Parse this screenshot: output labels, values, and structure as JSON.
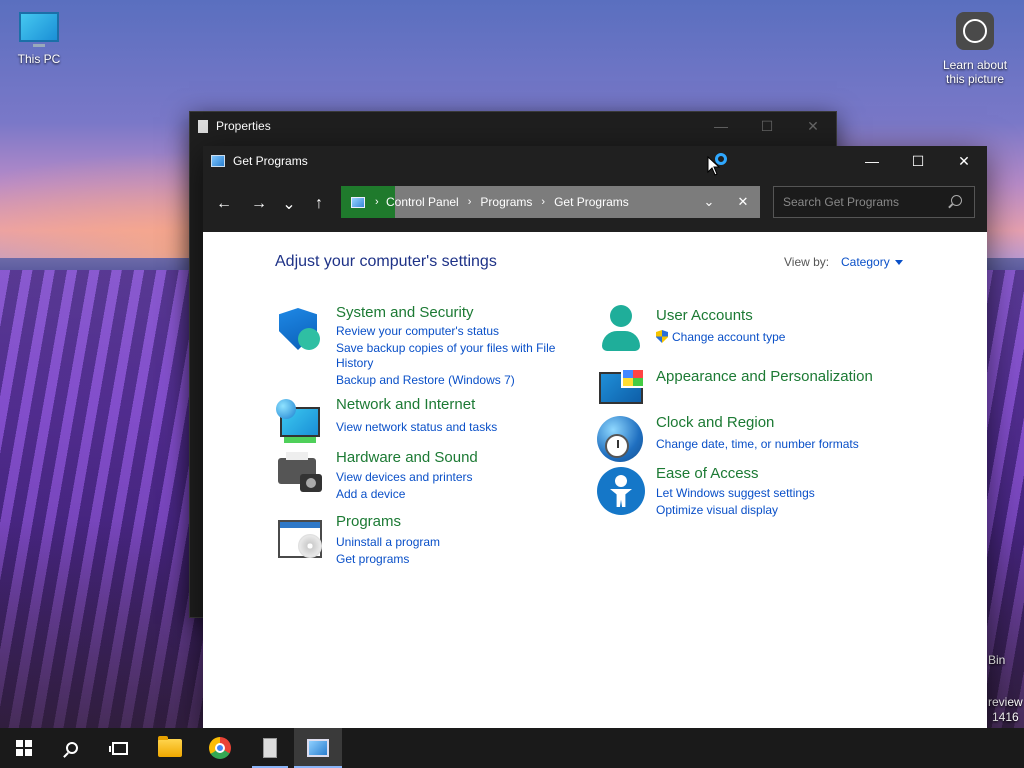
{
  "desktop": {
    "this_pc_label": "This PC",
    "learn_label_1": "Learn about",
    "learn_label_2": "this picture",
    "bin_fragment": "Bin",
    "watermark_line1": "review",
    "watermark_line2": "1416"
  },
  "properties_window": {
    "title": "Properties"
  },
  "window": {
    "title": "Get Programs",
    "minimize": "—",
    "maximize": "☐",
    "close": "✕"
  },
  "nav": {
    "back": "←",
    "forward": "→",
    "recent": "⌄",
    "up": "↑"
  },
  "address": {
    "crumbs": [
      "Control Panel",
      "Programs",
      "Get Programs"
    ],
    "separator": "›",
    "dropdown": "⌄",
    "clear": "✕"
  },
  "search": {
    "placeholder": "Search Get Programs"
  },
  "content": {
    "heading": "Adjust your computer's settings",
    "view_by_label": "View by:",
    "view_by_value": "Category",
    "left": [
      {
        "title": "System and Security",
        "icon": "shield-icon",
        "links": [
          "Review your computer's status",
          "Save backup copies of your files with File",
          "History",
          "Backup and Restore (Windows 7)"
        ]
      },
      {
        "title": "Network and Internet",
        "icon": "network-icon",
        "links": [
          "View network status and tasks"
        ]
      },
      {
        "title": "Hardware and Sound",
        "icon": "printer-icon",
        "links": [
          "View devices and printers",
          "Add a device"
        ]
      },
      {
        "title": "Programs",
        "icon": "programs-icon",
        "links": [
          "Uninstall a program",
          "Get programs"
        ]
      }
    ],
    "right": [
      {
        "title": "User Accounts",
        "icon": "user-icon",
        "links": [
          "Change account type"
        ]
      },
      {
        "title": "Appearance and Personalization",
        "icon": "appearance-icon",
        "links": []
      },
      {
        "title": "Clock and Region",
        "icon": "clock-globe-icon",
        "links": [
          "Change date, time, or number formats"
        ]
      },
      {
        "title": "Ease of Access",
        "icon": "ease-of-access-icon",
        "links": [
          "Let Windows suggest settings",
          "Optimize visual display"
        ]
      }
    ]
  },
  "taskbar": {
    "items": [
      "start-icon",
      "search-icon",
      "task-view-icon",
      "file-explorer-icon",
      "chrome-icon",
      "properties-icon",
      "control-panel-icon"
    ]
  },
  "colors": {
    "category_title": "#1c7a34",
    "link": "#0a50c8",
    "heading": "#1e3287",
    "address_highlight": "#1f7a2c"
  }
}
